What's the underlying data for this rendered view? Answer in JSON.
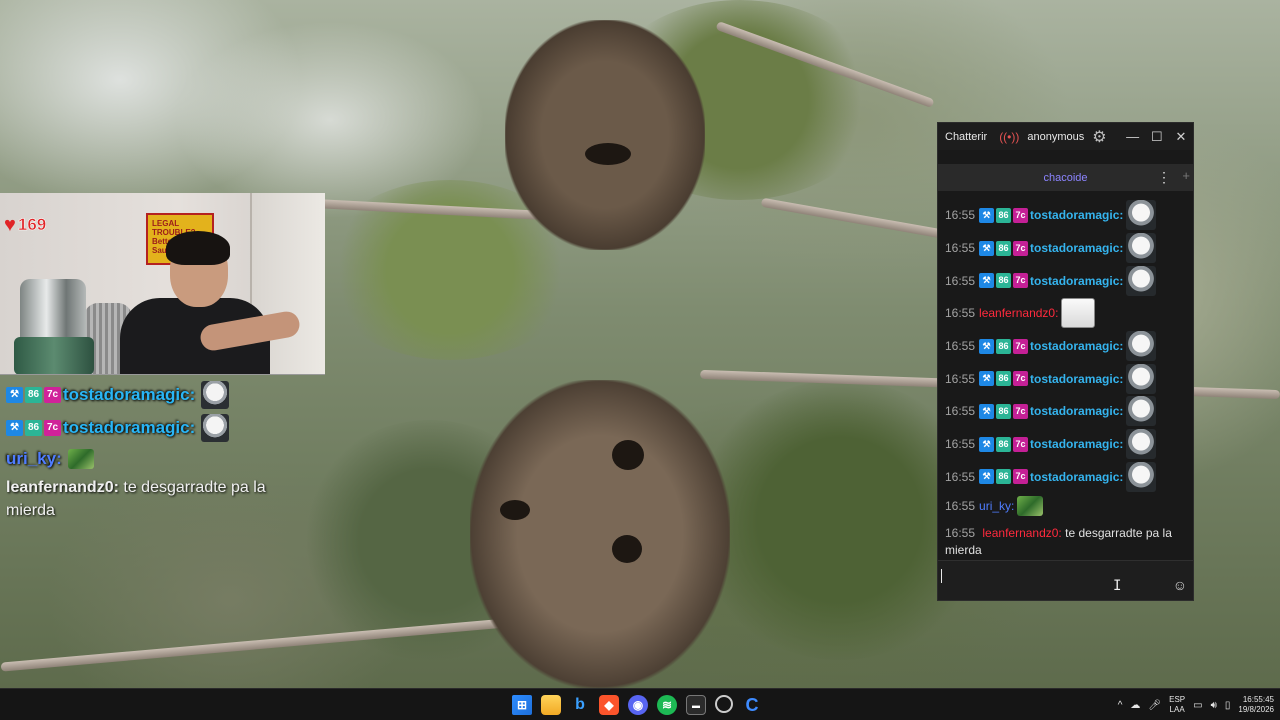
{
  "webcam": {
    "heart_count": "169",
    "poster_text": "LEGAL TROUBLE? Better Call Saul!"
  },
  "overlay_chat": {
    "lines": [
      {
        "user": "tostadoramagic:"
      },
      {
        "user": "tostadoramagic:"
      },
      {
        "user": "uri_ky:"
      },
      {
        "user": "leanfernandz0:",
        "text": "te desgarradte pa la mierda"
      }
    ]
  },
  "chatterino": {
    "window": {
      "app_name": "Chatterir",
      "account": "anonymous",
      "live_icon": "((•))",
      "gear_icon": "⚙",
      "minimize": "—",
      "maximize": "☐",
      "close": "✕"
    },
    "tab": {
      "channel": "chacoide",
      "menu_icon": "⋮",
      "add_icon": "+"
    },
    "messages": [
      {
        "time": "16:55",
        "user": "tostadoramagic:",
        "kind": "badged"
      },
      {
        "time": "16:55",
        "user": "tostadoramagic:",
        "kind": "badged"
      },
      {
        "time": "16:55",
        "user": "tostadoramagic:",
        "kind": "badged"
      },
      {
        "time": "16:55",
        "user": "leanfernandz0:",
        "kind": "plain-red"
      },
      {
        "time": "16:55",
        "user": "tostadoramagic:",
        "kind": "badged"
      },
      {
        "time": "16:55",
        "user": "tostadoramagic:",
        "kind": "badged"
      },
      {
        "time": "16:55",
        "user": "tostadoramagic:",
        "kind": "badged"
      },
      {
        "time": "16:55",
        "user": "tostadoramagic:",
        "kind": "badged"
      },
      {
        "time": "16:55",
        "user": "tostadoramagic:",
        "kind": "badged"
      },
      {
        "time": "16:55",
        "user": "uri_ky:",
        "kind": "plain-blue"
      },
      {
        "time": "16:55",
        "user": "leanfernandz0:",
        "text": "te desgarradte pa la mierda",
        "kind": "wrap"
      }
    ],
    "input": {
      "value": "",
      "emoji_icon": "☺"
    }
  },
  "taskbar": {
    "tray": {
      "chevron": "^",
      "lang_top": "ESP",
      "lang_bottom": "LAA",
      "time": "16:55:45",
      "date": "19/8/2026"
    }
  },
  "colors": {
    "chat_bg": "#191919",
    "tab_accent": "#8c84ff",
    "user_cyan": "#35b4ee",
    "user_red": "#ff2a3d",
    "user_blue": "#4f7dff",
    "taskbar_bg": "#151515"
  }
}
